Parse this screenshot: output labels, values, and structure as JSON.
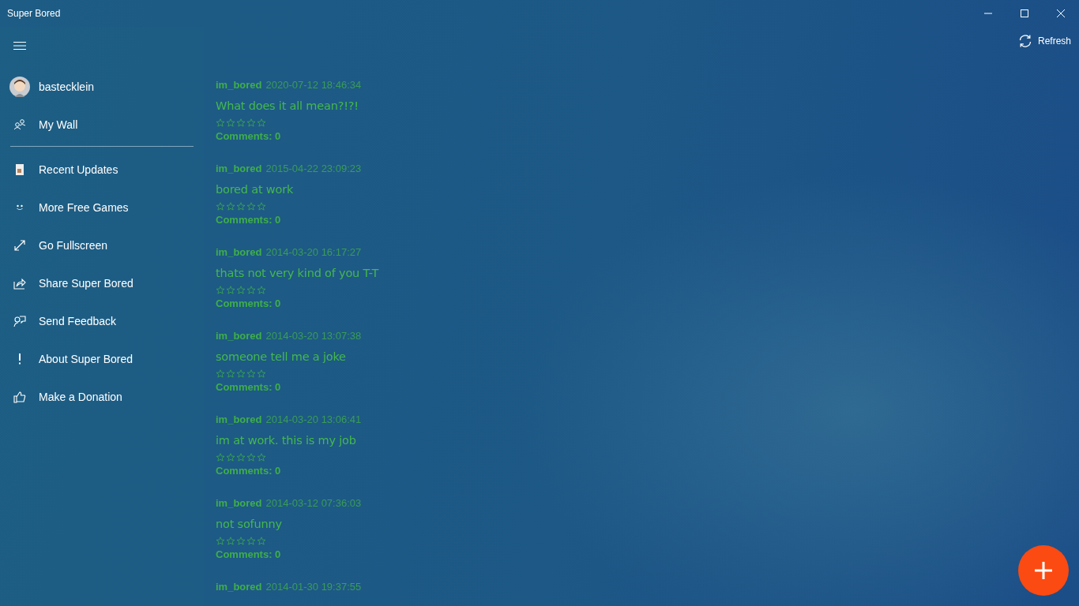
{
  "window": {
    "title": "Super Bored"
  },
  "toolbar": {
    "refresh": "Refresh"
  },
  "sidebar": {
    "user": {
      "name": "bastecklein"
    },
    "top_items": [
      "My Wall"
    ],
    "items": [
      "Recent Updates",
      "More Free Games",
      "Go Fullscreen",
      "Share Super Bored",
      "Send Feedback",
      "About Super Bored",
      "Make a Donation"
    ]
  },
  "posts": [
    {
      "author": "im_bored",
      "time": "2020-07-12 18:46:34",
      "title": "What does it all mean?!?!",
      "stars": 0,
      "comments": "Comments: 0"
    },
    {
      "author": "im_bored",
      "time": "2015-04-22 23:09:23",
      "title": "bored at work",
      "stars": 0,
      "comments": "Comments: 0"
    },
    {
      "author": "im_bored",
      "time": "2014-03-20 16:17:27",
      "title": "thats not very kind of you T-T",
      "stars": 0,
      "comments": "Comments: 0"
    },
    {
      "author": "im_bored",
      "time": "2014-03-20 13:07:38",
      "title": "someone tell me a joke",
      "stars": 0,
      "comments": "Comments: 0"
    },
    {
      "author": "im_bored",
      "time": "2014-03-20 13:06:41",
      "title": "im at work. this is my job",
      "stars": 0,
      "comments": "Comments: 0"
    },
    {
      "author": "im_bored",
      "time": "2014-03-12 07:36:03",
      "title": "not sofunny",
      "stars": 0,
      "comments": "Comments: 0"
    },
    {
      "author": "im_bored",
      "time": "2014-01-30 19:37:55"
    }
  ]
}
